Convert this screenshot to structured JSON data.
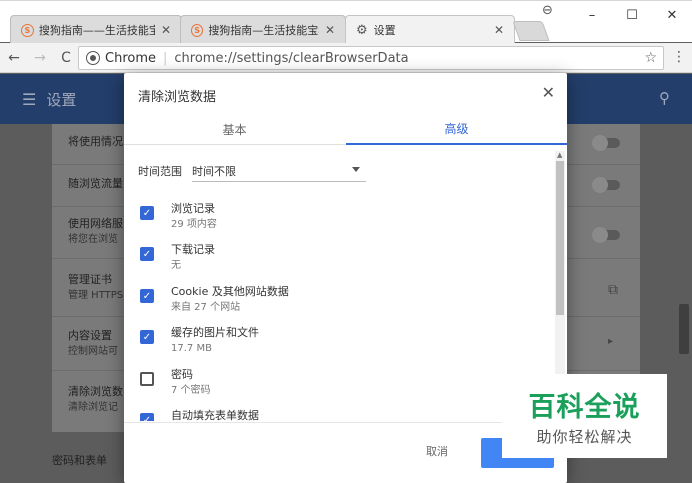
{
  "tabs": [
    {
      "title": "搜狗指南——生活技能宝",
      "state": "inactive"
    },
    {
      "title": "搜狗指南—生活技能宝典",
      "state": "inactive"
    },
    {
      "title": "设置",
      "state": "active"
    }
  ],
  "tab_close": "✕",
  "window_controls": {
    "minimize": "–",
    "maximize": "☐",
    "close": "✕"
  },
  "toolbar": {
    "back": "←",
    "forward": "→",
    "reload": "C",
    "omnibox_label": "Chrome",
    "url": "chrome://settings/clearBrowserData",
    "star": "☆",
    "menu": "⋮"
  },
  "settings": {
    "menu_icon": "☰",
    "title": "设置",
    "search_icon": "🔍",
    "rows": [
      {
        "label": "将使用情况",
        "sub": ""
      },
      {
        "label": "随浏览流量",
        "sub": ""
      },
      {
        "label": "使用网络服",
        "sub": "将您在浏览"
      },
      {
        "label": "管理证书",
        "sub": "管理 HTTPS"
      },
      {
        "label": "内容设置",
        "sub": "控制网站可"
      },
      {
        "label": "清除浏览数",
        "sub": "清除浏览记"
      }
    ],
    "section_label": "密码和表单"
  },
  "dialog": {
    "title": "清除浏览数据",
    "close": "✕",
    "tabs": {
      "basic": "基本",
      "advanced": "高级"
    },
    "time_range_label": "时间范围",
    "time_range_value": "时间不限",
    "items": [
      {
        "label": "浏览记录",
        "sub": "29 项内容",
        "checked": true
      },
      {
        "label": "下载记录",
        "sub": "无",
        "checked": true
      },
      {
        "label": "Cookie 及其他网站数据",
        "sub": "来自 27 个网站",
        "checked": true
      },
      {
        "label": "缓存的图片和文件",
        "sub": "17.7 MB",
        "checked": true
      },
      {
        "label": "密码",
        "sub": "7 个密码",
        "checked": false
      },
      {
        "label": "自动填充表单数据",
        "sub": "",
        "checked": true
      }
    ],
    "cancel_label": "取消",
    "confirm_label": ""
  },
  "watermark": {
    "main": "百科全说",
    "sub": "助你轻松解决"
  },
  "colors": {
    "accent": "#3367d6",
    "header": "#233e6b",
    "watermark": "#1aa05a"
  }
}
